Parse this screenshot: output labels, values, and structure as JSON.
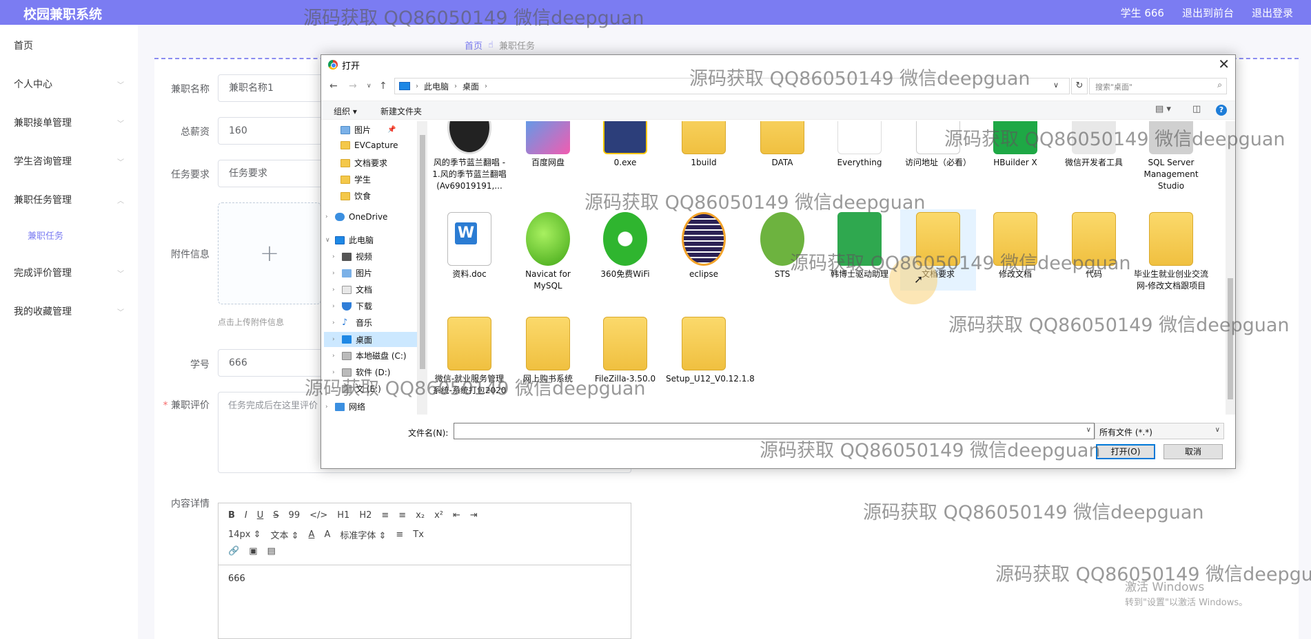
{
  "app": {
    "title": "校园兼职系统",
    "nav": [
      "学生 666",
      "退出到前台",
      "退出登录"
    ]
  },
  "sidebar": {
    "items": [
      "首页",
      "个人中心",
      "兼职接单管理",
      "学生咨询管理",
      "兼职任务管理",
      "完成评价管理",
      "我的收藏管理"
    ],
    "sub_item": "兼职任务"
  },
  "breadcrumb": {
    "home": "首页",
    "current": "兼职任务"
  },
  "form": {
    "name_label": "兼职名称",
    "name_value": "兼职名称1",
    "salary_label": "总薪资",
    "salary_value": "160",
    "req_label": "任务要求",
    "req_value": "任务要求",
    "attach_label": "附件信息",
    "attach_hint": "点击上传附件信息",
    "sid_label": "学号",
    "sid_value": "666",
    "eval_label": "兼职评价",
    "eval_placeholder": "任务完成后在这里评价",
    "content_label": "内容详情"
  },
  "editor": {
    "row1": [
      "B",
      "I",
      "U",
      "S",
      "99",
      "</>",
      "H1",
      "H2",
      "≡",
      "≡",
      "x₂",
      "x²",
      "⇤",
      "⇥"
    ],
    "row2": [
      "14px ⇕",
      "文本 ⇕",
      "A",
      "A",
      "标准字体 ⇕",
      "≡",
      "Tx"
    ],
    "row3": [
      "🔗",
      "▣",
      "▤"
    ],
    "content": "666"
  },
  "dialog": {
    "title": "打开",
    "path": [
      "此电脑",
      "桌面"
    ],
    "search_placeholder": "搜索\"桌面\"",
    "organize": "组织 ▾",
    "new_folder": "新建文件夹",
    "tree": [
      {
        "label": "图片",
        "pin": true
      },
      {
        "label": "EVCapture"
      },
      {
        "label": "文档要求"
      },
      {
        "label": "学生"
      },
      {
        "label": "饮食"
      },
      {
        "label": "OneDrive"
      },
      {
        "label": "此电脑"
      },
      {
        "label": "视频"
      },
      {
        "label": "图片"
      },
      {
        "label": "文档"
      },
      {
        "label": "下载"
      },
      {
        "label": "音乐"
      },
      {
        "label": "桌面"
      },
      {
        "label": "本地磁盘 (C:)"
      },
      {
        "label": "软件 (D:)"
      },
      {
        "label": "文 (E:)"
      },
      {
        "label": "网络"
      }
    ],
    "files_row1": [
      "风的季节蓝兰翻唱 - 1.风的季节蓝兰翻唱 (Av69019191,...",
      "百度网盘",
      "0.exe",
      "1build",
      "DATA",
      "Everything",
      "访问地址（必看）",
      "HBuilder X",
      "微信开发者工具",
      "SQL Server Management Studio"
    ],
    "files_row2": [
      "资料.doc",
      "Navicat for MySQL",
      "360免费WiFi",
      "eclipse",
      "STS",
      "韩博士驱动助理",
      "文档要求",
      "修改文档",
      "代码",
      "毕业生就业创业交流网-修改文档跟项目"
    ],
    "files_row3": [
      "微信-就业服务管理系统-系统打包2020",
      "网上购书系统",
      "FileZilla-3.50.0",
      "Setup_U12_V0.12.1.8"
    ],
    "filename_label": "文件名(N):",
    "filename_value": "",
    "filetype": "所有文件 (*.*)",
    "open_btn": "打开(O)",
    "cancel_btn": "取消"
  },
  "watermark": "源码获取 QQ86050149 微信deepguan",
  "activate_line1": "激活 Windows",
  "activate_line2": "转到\"设置\"以激活 Windows。",
  "colors": {
    "accent": "#7b7cf2",
    "selection": "#cce8ff",
    "folder": "#f4c84a"
  }
}
